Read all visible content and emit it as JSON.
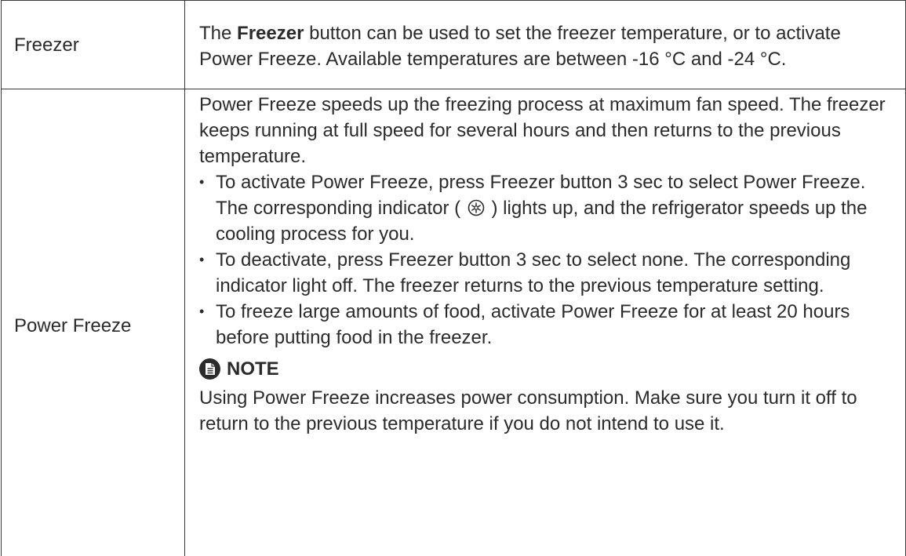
{
  "rows": [
    {
      "label": "Freezer",
      "desc_before": "The ",
      "desc_bold": "Freezer",
      "desc_after": " button can be used to set the freezer temperature, or to activate Power Freeze. Available temperatures are between -16 °C and -24 °C."
    },
    {
      "label": "Power Freeze",
      "intro": "Power Freeze speeds up the freezing process at maximum fan speed. The freezer keeps running at full speed for several hours and then returns to the previous temperature.",
      "bullet_char": "•",
      "bullets": [
        {
          "before": "To activate Power Freeze, press Freezer button 3 sec to select Power Freeze. The corresponding indicator ( ",
          "icon": "power-freeze-indicator-icon",
          "after": " ) lights up, and the refrigerator speeds up the cooling process for you."
        },
        {
          "text": "To deactivate, press Freezer button 3 sec to select none. The corresponding indicator light off. The freezer returns to the previous temperature setting."
        },
        {
          "text": "To freeze large amounts of food, activate Power Freeze for at least 20 hours before putting food in the freezer."
        }
      ],
      "note_icon": "note-icon",
      "note_title": "NOTE",
      "note_text": "Using Power Freeze increases power consumption. Make sure you turn it off to return to the previous temperature if you do not intend to use it."
    }
  ]
}
